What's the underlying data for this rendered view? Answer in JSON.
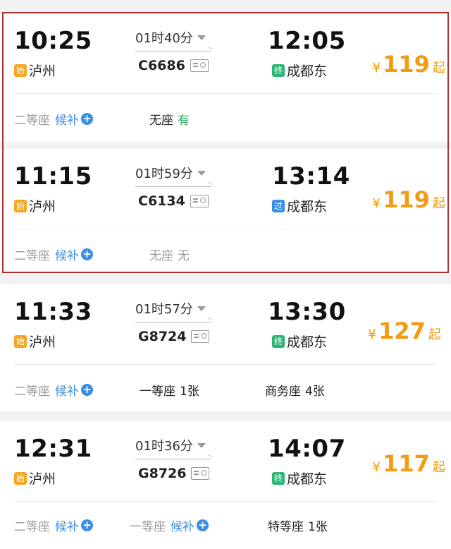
{
  "colors": {
    "accent_price": "#f39c12",
    "link_blue": "#3a8ee6",
    "available_green": "#27ae60",
    "highlight_border": "#b03030"
  },
  "icons": {
    "duration_caret": "chevron-down-icon",
    "id_card": "id-card-icon",
    "waitlist_plus": "plus-circle-icon"
  },
  "trains": [
    {
      "dep_time": "10:25",
      "dep_tag": "始",
      "dep_station": "泸州",
      "duration": "01时40分",
      "train_no": "C6686",
      "arr_time": "12:05",
      "arr_tag": "终",
      "arr_station": "成都东",
      "price_yen": "¥",
      "price": "119",
      "price_suffix": "起",
      "seats": [
        {
          "label": "二等座",
          "waitlist": "候补"
        },
        {
          "label": "无座",
          "value": "有"
        }
      ]
    },
    {
      "dep_time": "11:15",
      "dep_tag": "始",
      "dep_station": "泸州",
      "duration": "01时59分",
      "train_no": "C6134",
      "arr_time": "13:14",
      "arr_tag": "过",
      "arr_station": "成都东",
      "price_yen": "¥",
      "price": "119",
      "price_suffix": "起",
      "seats": [
        {
          "label": "二等座",
          "waitlist": "候补"
        },
        {
          "label": "无座",
          "value": "无"
        }
      ]
    },
    {
      "dep_time": "11:33",
      "dep_tag": "始",
      "dep_station": "泸州",
      "duration": "01时57分",
      "train_no": "G8724",
      "arr_time": "13:30",
      "arr_tag": "终",
      "arr_station": "成都东",
      "price_yen": "¥",
      "price": "127",
      "price_suffix": "起",
      "seats": [
        {
          "label": "二等座",
          "waitlist": "候补"
        },
        {
          "label": "一等座",
          "value": "1张"
        },
        {
          "label": "商务座",
          "value": "4张"
        }
      ]
    },
    {
      "dep_time": "12:31",
      "dep_tag": "始",
      "dep_station": "泸州",
      "duration": "01时36分",
      "train_no": "G8726",
      "arr_time": "14:07",
      "arr_tag": "终",
      "arr_station": "成都东",
      "price_yen": "¥",
      "price": "117",
      "price_suffix": "起",
      "seats": [
        {
          "label": "二等座",
          "waitlist": "候补"
        },
        {
          "label": "一等座",
          "waitlist": "候补"
        },
        {
          "label": "特等座",
          "value": "1张"
        }
      ]
    }
  ]
}
